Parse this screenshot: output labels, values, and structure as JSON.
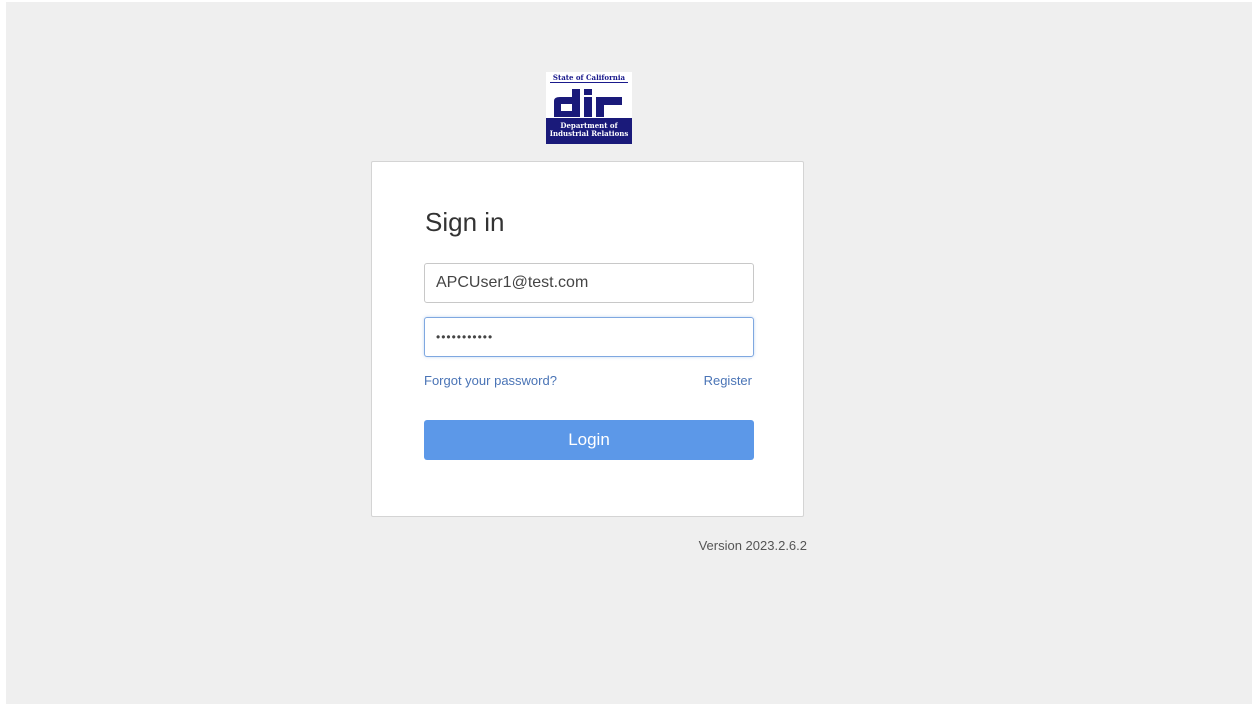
{
  "logo": {
    "state_text": "State of California",
    "mark_text": "dir",
    "dept_line1": "Department of",
    "dept_line2": "Industrial Relations",
    "colors": {
      "navy": "#1a1a7a",
      "white": "#ffffff"
    }
  },
  "signin": {
    "title": "Sign in",
    "email_value": "APCUser1@test.com",
    "password_value": "•••••••••••",
    "forgot_link": "Forgot your password?",
    "register_link": "Register",
    "login_button": "Login"
  },
  "footer": {
    "version": "Version 2023.2.6.2"
  },
  "theme": {
    "background": "#efefef",
    "accent": "#5c98e8",
    "link": "#4a74b6"
  }
}
